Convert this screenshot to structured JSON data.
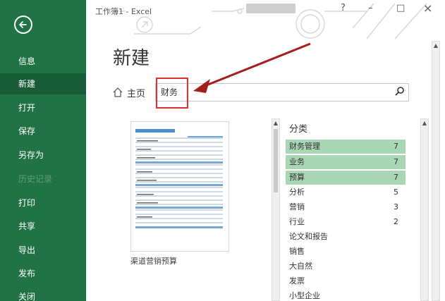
{
  "window": {
    "title": "工作簿1 - Excel",
    "help": "?",
    "minimize": "–",
    "maximize": "□",
    "close": "×"
  },
  "sidebar": {
    "items": [
      {
        "label": "信息",
        "state": "normal"
      },
      {
        "label": "新建",
        "state": "active"
      },
      {
        "label": "打开",
        "state": "normal"
      },
      {
        "label": "保存",
        "state": "normal"
      },
      {
        "label": "另存为",
        "state": "normal"
      },
      {
        "label": "历史记录",
        "state": "disabled"
      },
      {
        "label": "打印",
        "state": "normal"
      },
      {
        "label": "共享",
        "state": "normal"
      },
      {
        "label": "导出",
        "state": "normal"
      },
      {
        "label": "发布",
        "state": "normal"
      },
      {
        "label": "关闭",
        "state": "normal"
      }
    ],
    "colors": {
      "bg": "#217346",
      "active": "#185c37"
    }
  },
  "main": {
    "title": "新建",
    "home_link": "主页",
    "search": {
      "value": "财务"
    },
    "template": {
      "name": "渠道营销预算"
    },
    "category": {
      "title": "分类",
      "items": [
        {
          "name": "财务管理",
          "count": "7",
          "highlight": true
        },
        {
          "name": "业务",
          "count": "7",
          "highlight": true
        },
        {
          "name": "预算",
          "count": "7",
          "highlight": true
        },
        {
          "name": "分析",
          "count": "5",
          "highlight": false
        },
        {
          "name": "营销",
          "count": "3",
          "highlight": false
        },
        {
          "name": "行业",
          "count": "2",
          "highlight": false
        },
        {
          "name": "论文和报告",
          "count": "",
          "highlight": false
        },
        {
          "name": "销售",
          "count": "",
          "highlight": false
        },
        {
          "name": "大自然",
          "count": "",
          "highlight": false
        },
        {
          "name": "发票",
          "count": "",
          "highlight": false
        },
        {
          "name": "小型企业",
          "count": "",
          "highlight": false
        }
      ]
    },
    "annotation_color": "#e03030"
  }
}
